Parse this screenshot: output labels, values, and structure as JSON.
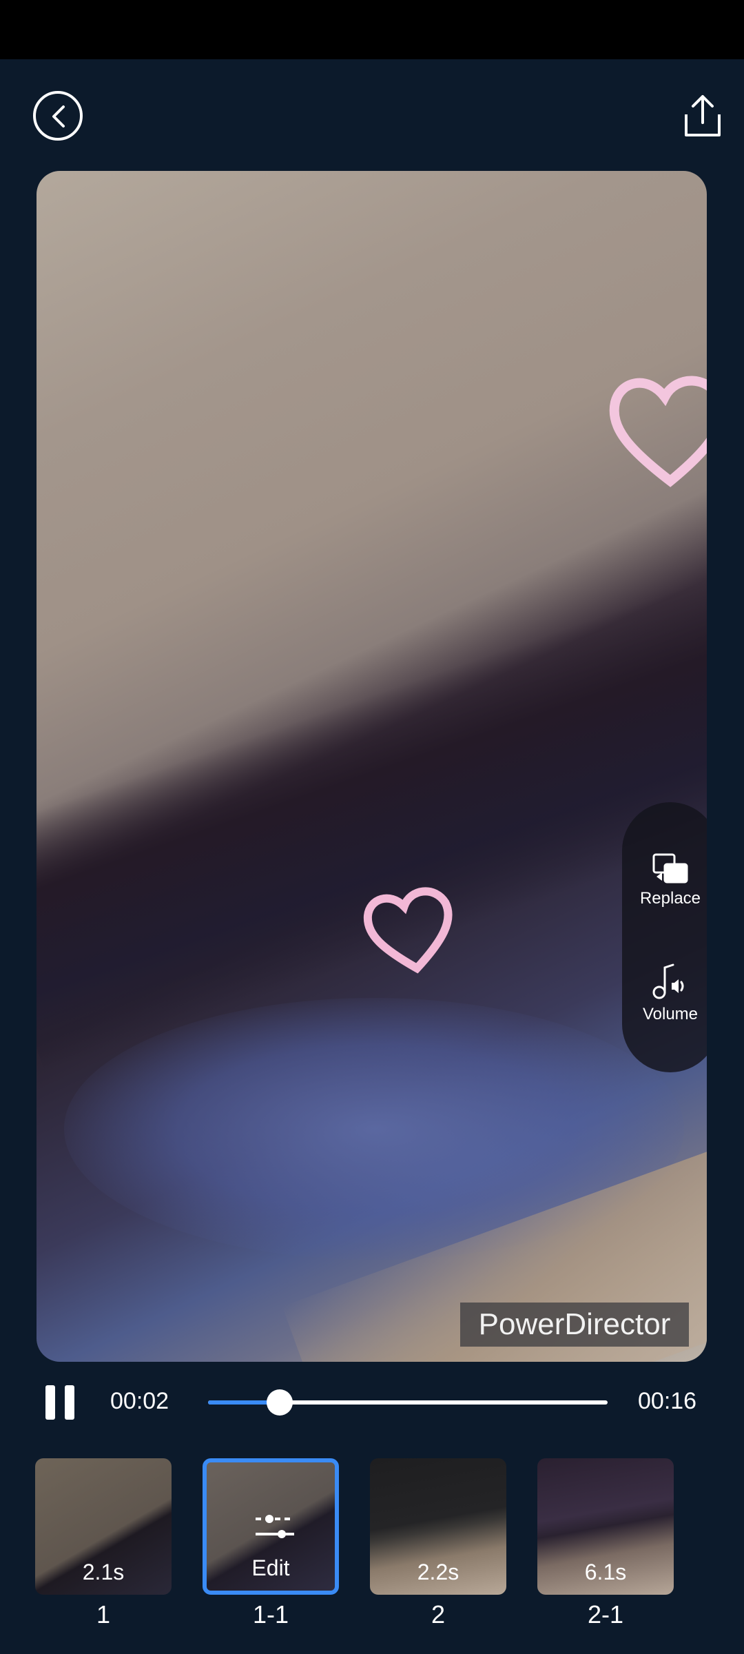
{
  "header": {
    "back_icon": "chevron-left-circle-icon",
    "share_icon": "share-upload-icon"
  },
  "preview": {
    "watermark": "PowerDirector",
    "side_panel": [
      {
        "label": "Replace",
        "icon": "replace-clip-icon"
      },
      {
        "label": "Volume",
        "icon": "music-volume-icon"
      }
    ]
  },
  "playback": {
    "current_time": "00:02",
    "total_time": "00:16",
    "progress": 0.18,
    "state_icon": "pause-icon"
  },
  "clips": [
    {
      "label": "1",
      "duration": "2.1s",
      "selected": false
    },
    {
      "label": "1-1",
      "duration": "",
      "edit_label": "Edit",
      "selected": true
    },
    {
      "label": "2",
      "duration": "2.2s",
      "selected": false
    },
    {
      "label": "2-1",
      "duration": "6.1s",
      "selected": false
    }
  ],
  "colors": {
    "background": "#0c1a2b",
    "accent": "#3a8bf5",
    "status_bar": "#000000"
  }
}
